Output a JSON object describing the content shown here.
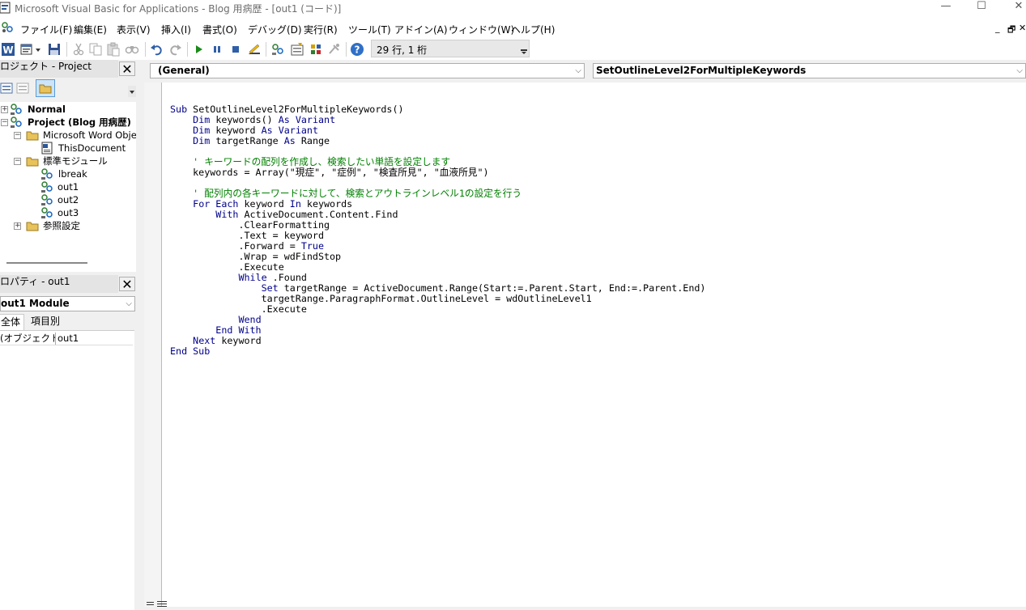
{
  "window": {
    "title": "Microsoft Visual Basic for Applications - Blog 用病歴 - [out1 (コード)]",
    "controls": [
      "—",
      "☐",
      "✕"
    ]
  },
  "menu": {
    "items": [
      "ファイル(F)",
      "編集(E)",
      "表示(V)",
      "挿入(I)",
      "書式(O)",
      "デバッグ(D)",
      "実行(R)",
      "ツール(T)",
      "アドイン(A)",
      "ウィンドウ(W)",
      "ヘルプ(H)"
    ],
    "mdi_controls": [
      "_",
      "🗗",
      "✕"
    ]
  },
  "toolbar": {
    "icons": [
      "word-icon",
      "insert-module-icon",
      "save-icon",
      "cut-icon",
      "copy-icon",
      "paste-icon",
      "find-icon",
      "undo-icon",
      "redo-icon",
      "run-icon",
      "break-icon",
      "reset-icon",
      "design-mode-icon",
      "project-explorer-icon",
      "properties-icon",
      "object-browser-icon",
      "toolbox-icon",
      "help-icon"
    ],
    "cursor_position": "29 行, 1 桁"
  },
  "project_pane": {
    "title": "ロジェクト - Project",
    "close": "✕",
    "tree": [
      {
        "label": "Normal",
        "bold": true
      },
      {
        "label": "Project (Blog 用病歴)",
        "bold": true
      },
      {
        "label": "Microsoft Word Object"
      },
      {
        "label": "ThisDocument"
      },
      {
        "label": "標準モジュール"
      },
      {
        "label": "lbreak"
      },
      {
        "label": "out1"
      },
      {
        "label": "out2"
      },
      {
        "label": "out3"
      },
      {
        "label": "参照設定"
      }
    ]
  },
  "properties_pane": {
    "title": "ロパティ - out1",
    "close": "✕",
    "object_combo": "out1 Module",
    "tabs": [
      "全体",
      "項目別"
    ],
    "rows": [
      {
        "name": "(オブジェクト名)",
        "value": "out1"
      }
    ]
  },
  "code_window": {
    "object_combo": "(General)",
    "procedure_combo": "SetOutlineLevel2ForMultipleKeywords",
    "lines": [
      [
        {
          "t": "Sub",
          "c": "kw"
        },
        {
          "t": " SetOutlineLevel2ForMultipleKeywords()"
        }
      ],
      [
        {
          "t": "    "
        },
        {
          "t": "Dim",
          "c": "kw"
        },
        {
          "t": " keywords() "
        },
        {
          "t": "As Variant",
          "c": "kw"
        }
      ],
      [
        {
          "t": "    "
        },
        {
          "t": "Dim",
          "c": "kw"
        },
        {
          "t": " keyword "
        },
        {
          "t": "As Variant",
          "c": "kw"
        }
      ],
      [
        {
          "t": "    "
        },
        {
          "t": "Dim",
          "c": "kw"
        },
        {
          "t": " targetRange "
        },
        {
          "t": "As",
          "c": "kw"
        },
        {
          "t": " Range"
        }
      ],
      [
        {
          "t": ""
        }
      ],
      [
        {
          "t": "    ' キーワードの配列を作成し、検索したい単語を設定します",
          "c": "cm"
        }
      ],
      [
        {
          "t": "    keywords = Array(\"現症\", \"症例\", \"検査所見\", \"血液所見\")"
        }
      ],
      [
        {
          "t": ""
        }
      ],
      [
        {
          "t": "    ' 配列内の各キーワードに対して、検索とアウトラインレベル1の設定を行う",
          "c": "cm"
        }
      ],
      [
        {
          "t": "    "
        },
        {
          "t": "For Each",
          "c": "kw"
        },
        {
          "t": " keyword "
        },
        {
          "t": "In",
          "c": "kw"
        },
        {
          "t": " keywords"
        }
      ],
      [
        {
          "t": "        "
        },
        {
          "t": "With",
          "c": "kw"
        },
        {
          "t": " ActiveDocument.Content.Find"
        }
      ],
      [
        {
          "t": "            .ClearFormatting"
        }
      ],
      [
        {
          "t": "            .Text = keyword"
        }
      ],
      [
        {
          "t": "            .Forward = "
        },
        {
          "t": "True",
          "c": "kw"
        }
      ],
      [
        {
          "t": "            .Wrap = wdFindStop"
        }
      ],
      [
        {
          "t": "            .Execute"
        }
      ],
      [
        {
          "t": "            "
        },
        {
          "t": "While",
          "c": "kw"
        },
        {
          "t": " .Found"
        }
      ],
      [
        {
          "t": "                "
        },
        {
          "t": "Set",
          "c": "kw"
        },
        {
          "t": " targetRange = ActiveDocument.Range(Start:=.Parent.Start, End:=.Parent.End)"
        }
      ],
      [
        {
          "t": "                targetRange.ParagraphFormat.OutlineLevel = wdOutlineLevel1"
        }
      ],
      [
        {
          "t": "                .Execute"
        }
      ],
      [
        {
          "t": "            "
        },
        {
          "t": "Wend",
          "c": "kw"
        }
      ],
      [
        {
          "t": "        "
        },
        {
          "t": "End With",
          "c": "kw"
        }
      ],
      [
        {
          "t": "    "
        },
        {
          "t": "Next",
          "c": "kw"
        },
        {
          "t": " keyword"
        }
      ],
      [
        {
          "t": "End Sub",
          "c": "kw"
        }
      ]
    ]
  }
}
